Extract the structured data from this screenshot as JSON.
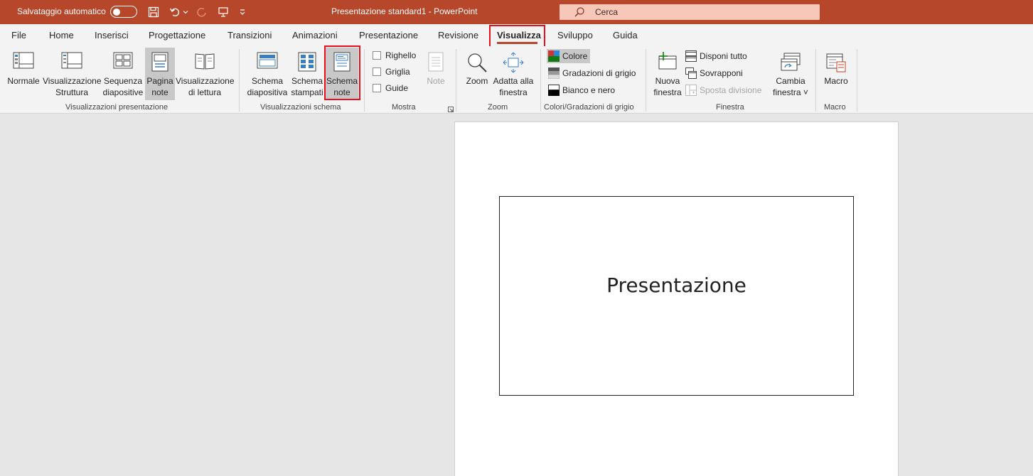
{
  "titlebar": {
    "autosave_label": "Salvataggio automatico",
    "document_title": "Presentazione standard1  -  PowerPoint",
    "search_placeholder": "Cerca"
  },
  "tabs": [
    {
      "label": "File"
    },
    {
      "label": "Home"
    },
    {
      "label": "Inserisci"
    },
    {
      "label": "Progettazione"
    },
    {
      "label": "Transizioni"
    },
    {
      "label": "Animazioni"
    },
    {
      "label": "Presentazione"
    },
    {
      "label": "Revisione"
    },
    {
      "label": "Visualizza"
    },
    {
      "label": "Sviluppo"
    },
    {
      "label": "Guida"
    }
  ],
  "active_tab": "Visualizza",
  "groups": {
    "presentation_views": {
      "label": "Visualizzazioni presentazione",
      "normale": "Normale",
      "struttura_1": "Visualizzazione",
      "struttura_2": "Struttura",
      "sequenza_1": "Sequenza",
      "sequenza_2": "diapositive",
      "pagina_1": "Pagina",
      "pagina_2": "note",
      "lettura_1": "Visualizzazione",
      "lettura_2": "di lettura"
    },
    "master_views": {
      "label": "Visualizzazioni schema",
      "diap_1": "Schema",
      "diap_2": "diapositiva",
      "stamp_1": "Schema",
      "stamp_2": "stampati",
      "note_1": "Schema",
      "note_2": "note"
    },
    "show": {
      "label": "Mostra",
      "righello": "Righello",
      "griglia": "Griglia",
      "guide": "Guide",
      "note": "Note"
    },
    "zoom": {
      "label": "Zoom",
      "zoom": "Zoom",
      "fit_1": "Adatta alla",
      "fit_2": "finestra"
    },
    "color": {
      "label": "Colori/Gradazioni di grigio",
      "colore": "Colore",
      "grigio": "Gradazioni di grigio",
      "bianco_nero": "Bianco e nero"
    },
    "window": {
      "label": "Finestra",
      "nuova_1": "Nuova",
      "nuova_2": "finestra",
      "disponi": "Disponi tutto",
      "sovrapponi": "Sovrapponi",
      "sposta": "Sposta divisione",
      "cambia_1": "Cambia",
      "cambia_2": "finestra"
    },
    "macro": {
      "label": "Macro",
      "macro": "Macro"
    }
  },
  "slide": {
    "title": "Presentazione"
  },
  "colors": {
    "accent": "#b7472a",
    "highlight": "#e8101a",
    "search_bg": "#f7c8b9"
  }
}
